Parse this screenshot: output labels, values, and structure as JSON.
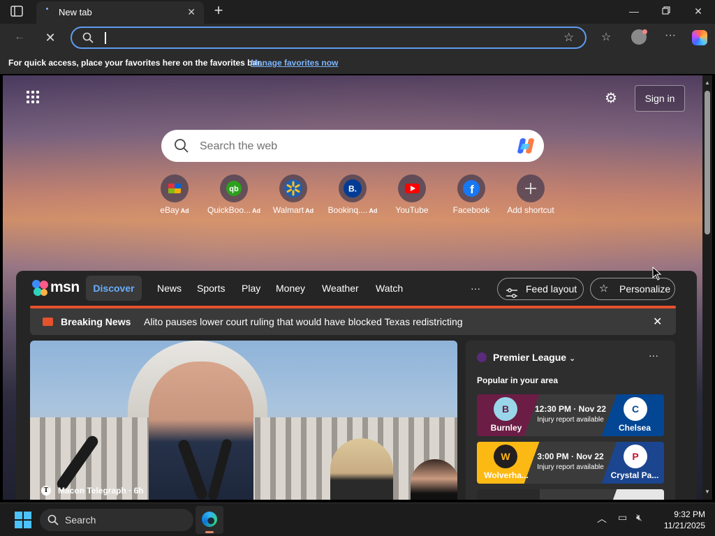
{
  "browser": {
    "tab_title": "New tab",
    "favorites_hint": "For quick access, place your favorites here on the favorites bar.",
    "manage_favorites_link": "Manage favorites now"
  },
  "ntp": {
    "signin_label": "Sign in",
    "search_placeholder": "Search the web",
    "shortcuts": [
      {
        "label": "eBay",
        "ad": "Ad",
        "icon": "ebay-icon"
      },
      {
        "label": "QuickBoo...",
        "ad": "Ad",
        "icon": "quickbooks-icon"
      },
      {
        "label": "Walmart",
        "ad": "Ad",
        "icon": "walmart-icon"
      },
      {
        "label": "Bookinq....",
        "ad": "Ad",
        "icon": "booking-icon"
      },
      {
        "label": "YouTube",
        "ad": "",
        "icon": "youtube-icon"
      },
      {
        "label": "Facebook",
        "ad": "",
        "icon": "facebook-icon"
      },
      {
        "label": "Add shortcut",
        "ad": "",
        "icon": "plus-icon"
      }
    ]
  },
  "msn": {
    "logo": "msn",
    "tabs": [
      "Discover",
      "News",
      "Sports",
      "Play",
      "Money",
      "Weather",
      "Watch"
    ],
    "more": "···",
    "feed_layout_label": "Feed layout",
    "personalize_label": "Personalize",
    "breaking": {
      "label": "Breaking News",
      "headline": "Alito pauses lower court ruling that would have blocked Texas redistricting"
    },
    "hero": {
      "source": "Macon Telegraph",
      "age": "6h",
      "source_icon": "T"
    },
    "premier_league": {
      "title": "Premier League",
      "subtitle": "Popular in your area",
      "matches": [
        {
          "home": "Burnley",
          "away": "Chelsea",
          "time": "12:30 PM · Nov 22",
          "note": "Injury report available",
          "home_color": "#6c1d45",
          "away_color": "#034694"
        },
        {
          "home": "Wolverha...",
          "away": "Crystal Pa...",
          "time": "3:00 PM · Nov 22",
          "note": "Injury report available",
          "home_color": "#fdb913",
          "away_color": "#1b458f"
        }
      ]
    }
  },
  "taskbar": {
    "search_label": "Search",
    "time": "9:32 PM",
    "date": "11/21/2025"
  },
  "colors": {
    "accent": "#5e9cf0",
    "breaking_red": "#e5522e",
    "discover_blue": "#6aaeff"
  }
}
